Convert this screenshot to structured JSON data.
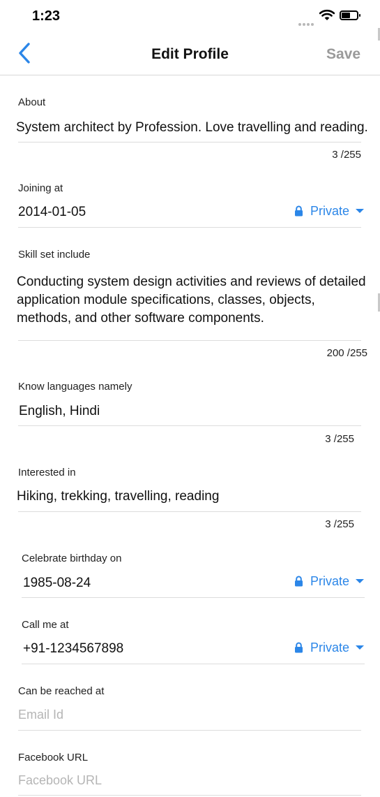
{
  "status_bar": {
    "time": "1:23"
  },
  "nav": {
    "title": "Edit Profile",
    "save_label": "Save"
  },
  "about": {
    "label": "About",
    "value": "System architect by Profession. Love travelling and reading.",
    "counter": "3 /255"
  },
  "joining": {
    "label": "Joining at",
    "value": "2014-01-05",
    "privacy": "Private"
  },
  "skills": {
    "label": "Skill set include",
    "value": "Conducting system design activities and reviews of detailed application module specifications, classes, objects, methods, and other software components.",
    "counter": "200 /255"
  },
  "languages": {
    "label": "Know languages namely",
    "value": "English, Hindi",
    "counter": "3 /255"
  },
  "interests": {
    "label": "Interested in",
    "value": "Hiking, trekking, travelling, reading",
    "counter": "3 /255"
  },
  "birthday": {
    "label": "Celebrate birthday on",
    "value": "1985-08-24",
    "privacy": "Private"
  },
  "phone": {
    "label": "Call me at",
    "value": "+91-1234567898",
    "privacy": "Private"
  },
  "email": {
    "label": "Can be reached at",
    "placeholder": "Email Id"
  },
  "facebook": {
    "label": "Facebook URL",
    "placeholder": "Facebook URL"
  },
  "colors": {
    "accent": "#2b86e8",
    "save_disabled": "#9a9a9a",
    "divider": "#dcdcdc",
    "placeholder": "#b5b5b5"
  }
}
